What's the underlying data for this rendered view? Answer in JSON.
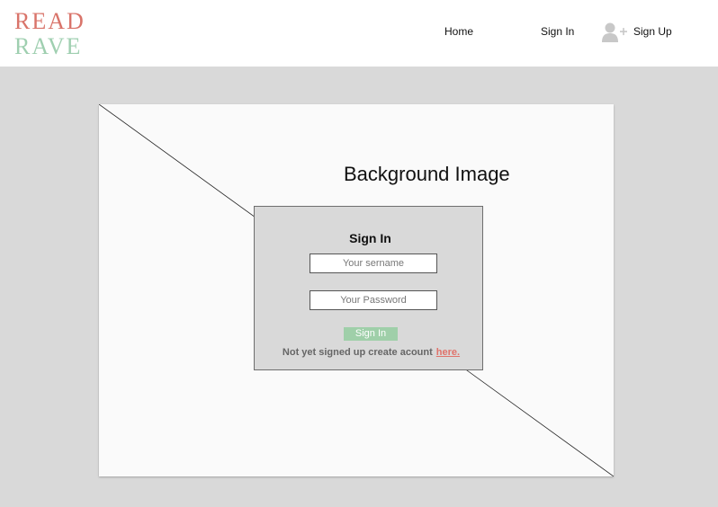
{
  "logo": {
    "line1": "READ",
    "line2": "RAVE",
    "color_line1": "#d9746a",
    "color_line2": "#9fcfb0"
  },
  "nav": {
    "home": "Home",
    "sign_in": "Sign In",
    "sign_up": "Sign Up",
    "sign_up_icon": "user-plus-icon"
  },
  "hero": {
    "placeholder_label": "Background Image"
  },
  "signin_form": {
    "title": "Sign In",
    "username_placeholder": "Your sername",
    "password_placeholder": "Your Password",
    "submit_label": "Sign In",
    "signup_prompt": "Not yet signed up create acount",
    "signup_link": "here.",
    "accent_color": "#9fcfa9",
    "link_color": "#e0736b"
  }
}
